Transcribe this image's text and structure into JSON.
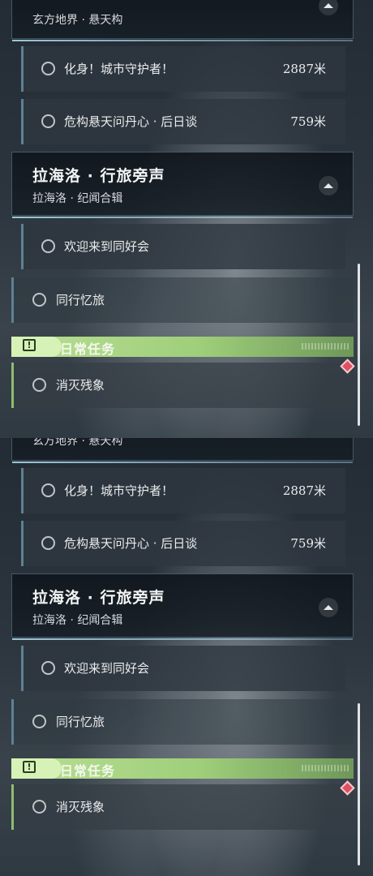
{
  "section_top_cut": {
    "subtitle": "玄方地界 · 悬天构"
  },
  "quests_a": [
    {
      "name": "化身！城市守护者！",
      "distance": "2887米"
    },
    {
      "name": "危构悬天问丹心 · 后日谈",
      "distance": "759米"
    }
  ],
  "section_lahailuo": {
    "title": "拉海洛 · 行旅旁声",
    "subtitle": "拉海洛 · 纪闻合辑"
  },
  "quests_b": [
    {
      "name": "欢迎来到同好会"
    }
  ],
  "main_quest": {
    "name": "同行忆旅"
  },
  "daily": {
    "label": "日常任务",
    "quest_name": "消灭残象"
  },
  "colors": {
    "daily_accent": "#a9d484",
    "marker": "#e05060",
    "divider": "#aad7eb"
  },
  "icons": {
    "collapse": "chevron-up-icon",
    "status": "circle-ring-icon",
    "daily": "alert-box-icon",
    "marker": "diamond-marker-icon"
  }
}
